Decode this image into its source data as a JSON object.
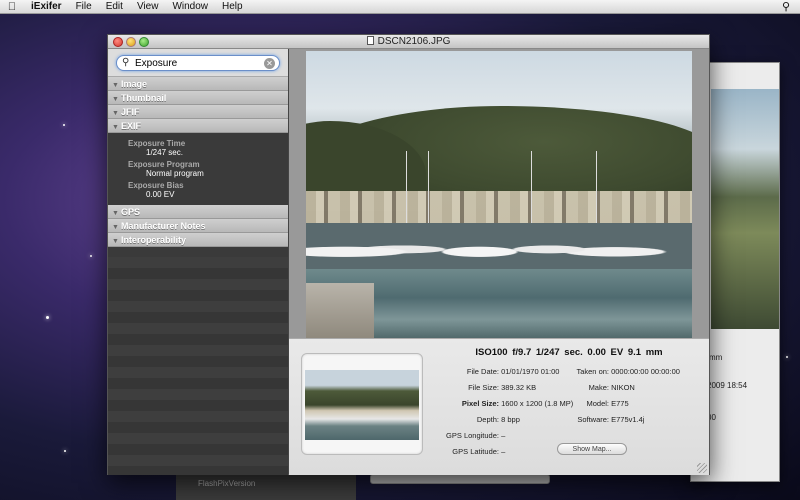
{
  "menubar": {
    "app": "iExifer",
    "items": [
      "File",
      "Edit",
      "View",
      "Window",
      "Help"
    ]
  },
  "window": {
    "title": "DSCN2106.JPG"
  },
  "search": {
    "value": "Exposure"
  },
  "sidebar": {
    "sections": {
      "image": "Image",
      "thumbnail": "Thumbnail",
      "jfif": "JFIF",
      "exif": "EXIF",
      "gps": "GPS",
      "manufacturer": "Manufacturer Notes",
      "interop": "Interoperability"
    },
    "exif_items": [
      {
        "key": "Exposure Time",
        "value": "1/247 sec."
      },
      {
        "key": "Exposure Program",
        "value": "Normal program"
      },
      {
        "key": "Exposure Bias",
        "value": "0.00 EV"
      }
    ]
  },
  "info": {
    "summary": "ISO100  f/9.7  1/247 sec.  0.00 EV  9.1 mm",
    "left": [
      {
        "label": "File Date:",
        "value": "01/01/1970 01:00"
      },
      {
        "label": "File Size:",
        "value": "389.32 KB"
      },
      {
        "label": "Pixel Size:",
        "value": "1600 x 1200 (1.8 MP)"
      },
      {
        "label": "Depth:",
        "value": "8 bpp"
      },
      {
        "label": "GPS Longitude:",
        "value": "–"
      },
      {
        "label": "GPS Latitude:",
        "value": "–"
      }
    ],
    "right": [
      {
        "label": "Taken on:",
        "value": "0000:00:00 00:00:00"
      },
      {
        "label": "Make:",
        "value": "NIKON"
      },
      {
        "label": "Model:",
        "value": "E775"
      },
      {
        "label": "Software:",
        "value": "E775v1.4j"
      }
    ],
    "show_map": "Show Map..."
  },
  "background_window": {
    "t1": "mm",
    "t2": "2009 18:54",
    "t3": "00"
  },
  "stub_window": {
    "label": "FlashPixVersion"
  }
}
